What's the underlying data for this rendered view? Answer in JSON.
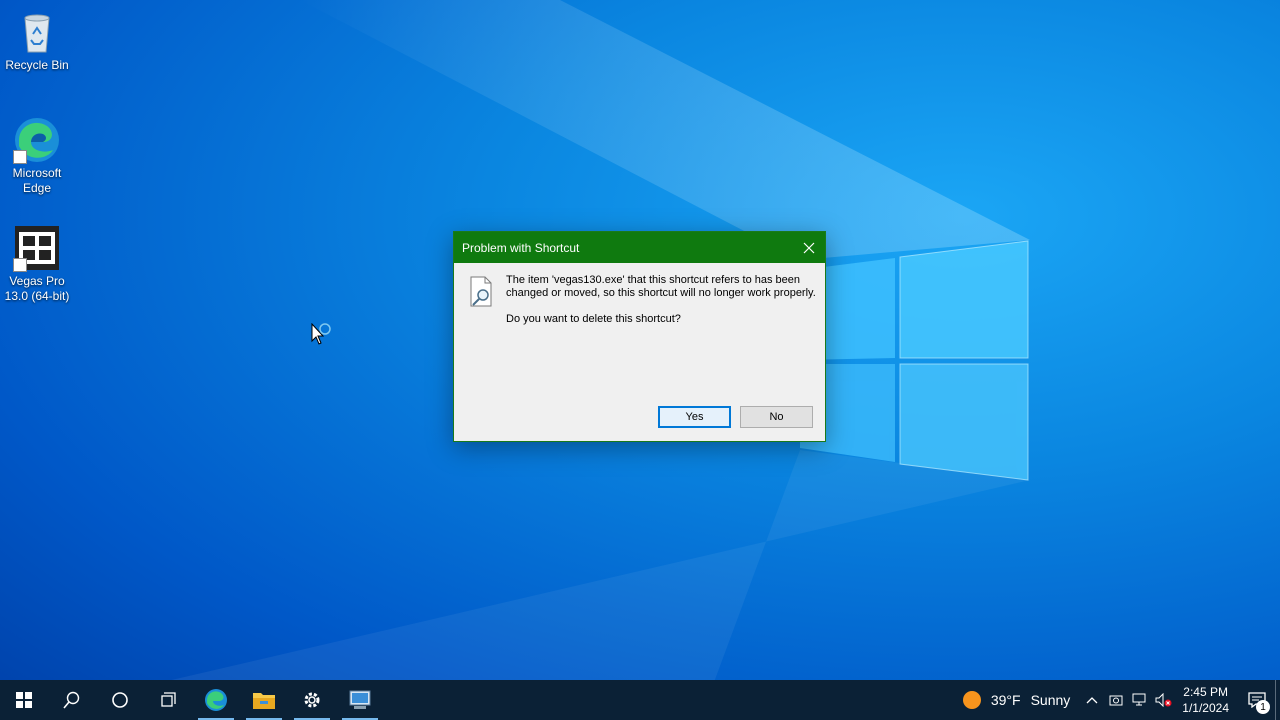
{
  "desktop": {
    "icons": [
      {
        "label": "Recycle Bin",
        "icon": "recycle-bin-icon"
      },
      {
        "label": "Microsoft Edge",
        "icon": "edge-icon"
      },
      {
        "label": "Vegas Pro 13.0 (64-bit)",
        "icon": "vegas-pro-icon"
      }
    ]
  },
  "dialog": {
    "title": "Problem with Shortcut",
    "message": "The item 'vegas130.exe' that this shortcut refers to has been changed or moved, so this shortcut will no longer work properly.",
    "question": "Do you want to delete this shortcut?",
    "yes_label": "Yes",
    "no_label": "No",
    "titlebar_color": "#0f7a0f"
  },
  "taskbar": {
    "buttons": [
      "start-icon",
      "search-icon",
      "cortana-icon",
      "task-view-icon",
      "edge-icon",
      "file-explorer-icon",
      "settings-icon",
      "control-panel-icon"
    ],
    "weather": {
      "temp": "39°F",
      "condition": "Sunny"
    },
    "clock": {
      "time": "2:45 PM",
      "date": "1/1/2024"
    },
    "notification_count": "1"
  }
}
